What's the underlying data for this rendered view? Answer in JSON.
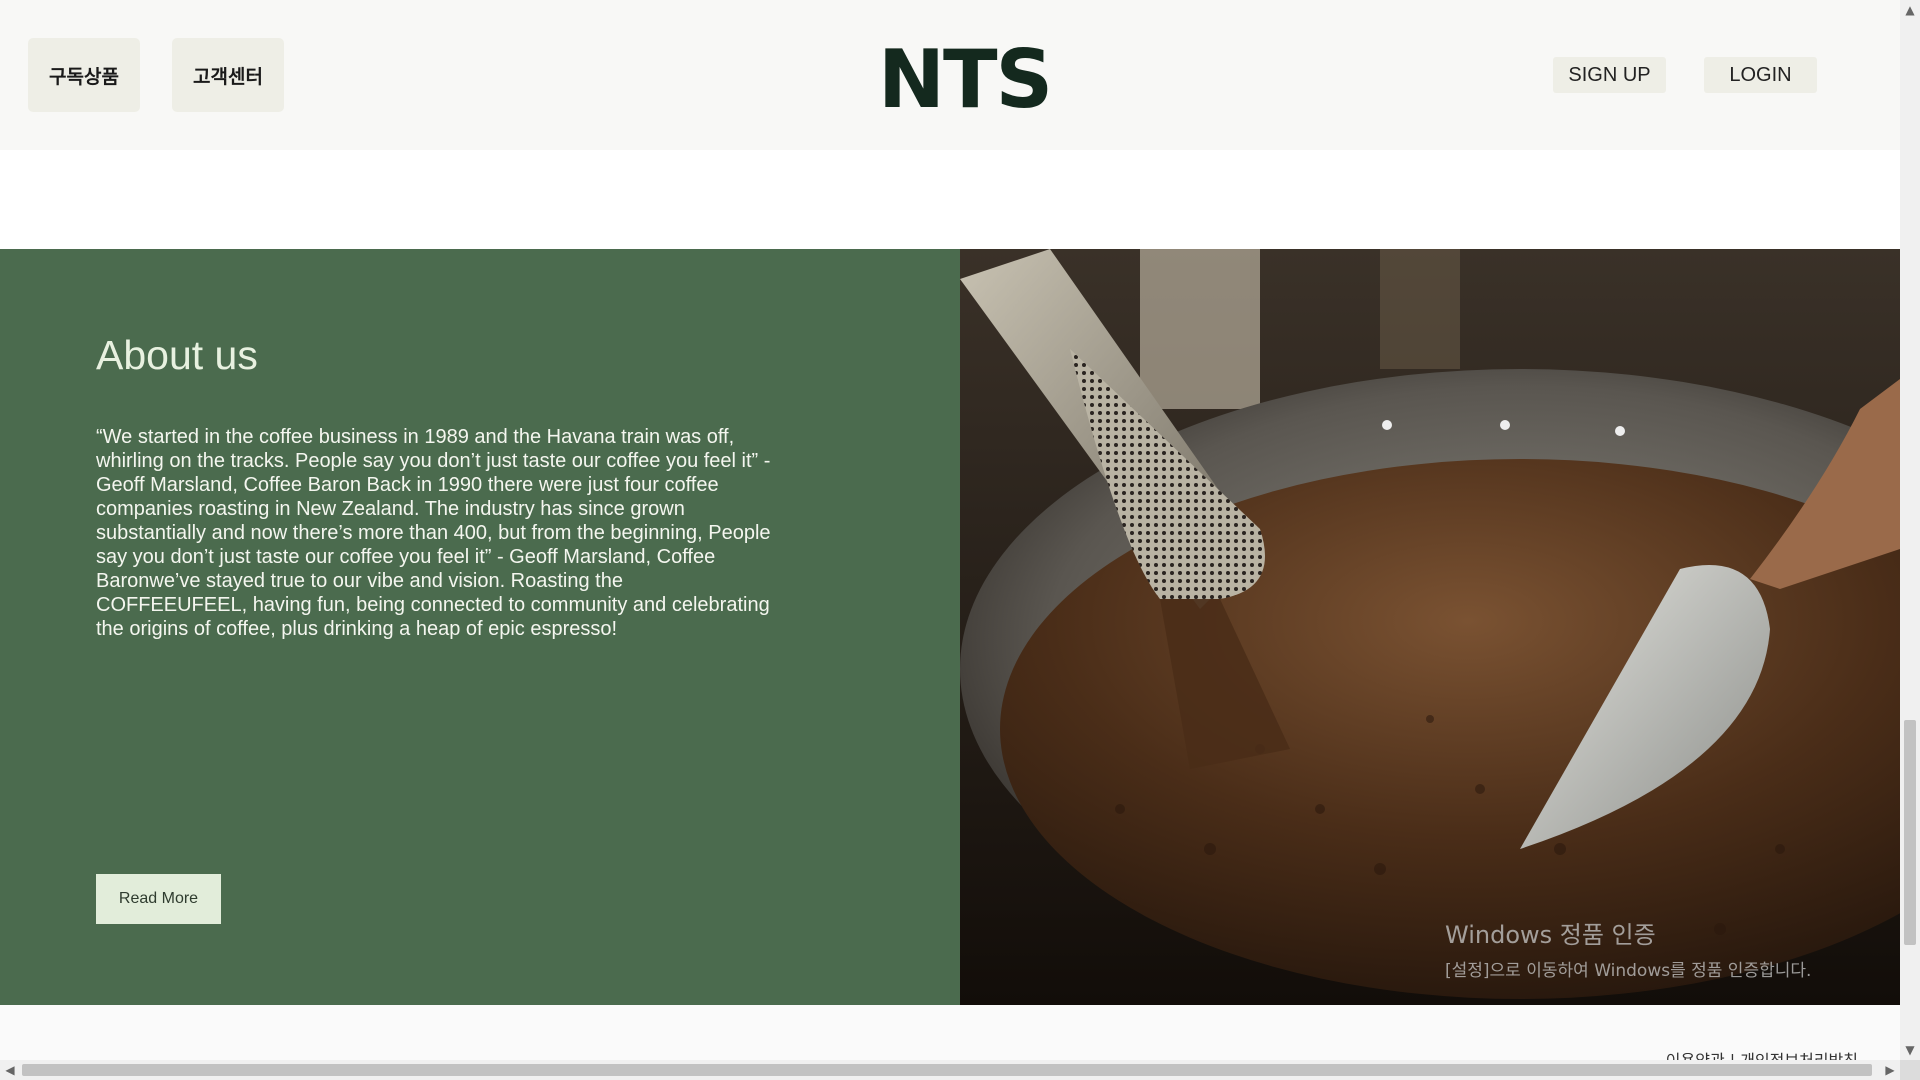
{
  "header": {
    "nav": [
      "구독상품",
      "고객센터"
    ],
    "logo": "NTS",
    "sign_up": "SIGN UP",
    "login": "LOGIN"
  },
  "about": {
    "title": "About us",
    "body": "“We started in the coffee business in 1989 and the Havana train was off, whirling on the tracks. People say you don’t just taste our coffee you feel it” - Geoff Marsland, Coffee Baron Back in 1990 there were just four coffee companies roasting in New Zealand. The industry has since grown substantially and now there’s more than 400, but from the beginning, People say you don’t just taste our coffee you feel it” - Geoff Marsland, Coffee Baronwe’ve stayed true to our vibe and vision. Roasting the COFFEEUFEEL, having fun, being connected to community and celebrating the origins of coffee, plus drinking a heap of epic espresso!",
    "read_more": "Read More",
    "image_icon": "coffee-roaster-photo"
  },
  "watermark": {
    "line1": "Windows 정품 인증",
    "line2": "[설정]으로 이동하여 Windows를 정품 인증합니다."
  },
  "footer": {
    "link": "이용약관 | 개인정보처리방침"
  },
  "colors": {
    "about_bg": "#4b6b4e",
    "logo": "#14291e",
    "button_bg": "#eeeee6"
  }
}
